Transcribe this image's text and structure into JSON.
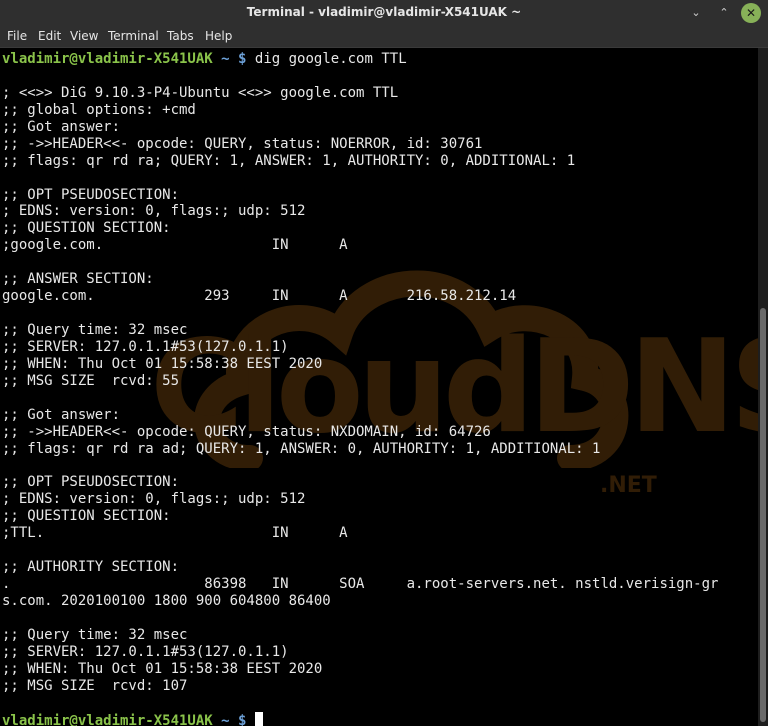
{
  "window": {
    "title": "Terminal - vladimir@vladimir-X541UAK ~",
    "minimize_icon": "minimize-icon",
    "maximize_icon": "maximize-icon",
    "close_icon": "close-icon",
    "minimize_glyph": "⌄",
    "maximize_glyph": "⌃",
    "close_glyph": "✕"
  },
  "menu": {
    "items": [
      "File",
      "Edit",
      "View",
      "Terminal",
      "Tabs",
      "Help"
    ]
  },
  "watermark": {
    "text": "CloudDNS",
    "suffix": ".NET"
  },
  "prompt": {
    "user_host": "vladimir@vladimir-X541UAK",
    "path": "~",
    "symbol": "$"
  },
  "command": "dig google.com TTL",
  "output_lines": [
    "",
    "; <<>> DiG 9.10.3-P4-Ubuntu <<>> google.com TTL",
    ";; global options: +cmd",
    ";; Got answer:",
    ";; ->>HEADER<<- opcode: QUERY, status: NOERROR, id: 30761",
    ";; flags: qr rd ra; QUERY: 1, ANSWER: 1, AUTHORITY: 0, ADDITIONAL: 1",
    "",
    ";; OPT PSEUDOSECTION:",
    "; EDNS: version: 0, flags:; udp: 512",
    ";; QUESTION SECTION:",
    ";google.com.                    IN      A",
    "",
    ";; ANSWER SECTION:",
    "google.com.             293     IN      A       216.58.212.14",
    "",
    ";; Query time: 32 msec",
    ";; SERVER: 127.0.1.1#53(127.0.1.1)",
    ";; WHEN: Thu Oct 01 15:58:38 EEST 2020",
    ";; MSG SIZE  rcvd: 55",
    "",
    ";; Got answer:",
    ";; ->>HEADER<<- opcode: QUERY, status: NXDOMAIN, id: 64726",
    ";; flags: qr rd ra ad; QUERY: 1, ANSWER: 0, AUTHORITY: 1, ADDITIONAL: 1",
    "",
    ";; OPT PSEUDOSECTION:",
    "; EDNS: version: 0, flags:; udp: 512",
    ";; QUESTION SECTION:",
    ";TTL.                           IN      A",
    "",
    ";; AUTHORITY SECTION:",
    ".                       86398   IN      SOA     a.root-servers.net. nstld.verisign-gr",
    "s.com. 2020100100 1800 900 604800 86400",
    "",
    ";; Query time: 32 msec",
    ";; SERVER: 127.0.1.1#53(127.0.1.1)",
    ";; WHEN: Thu Oct 01 15:58:38 EEST 2020",
    ";; MSG SIZE  rcvd: 107",
    ""
  ],
  "colors": {
    "user_host": "#8ac34a",
    "path": "#6da1d8",
    "text": "#e8e8e8",
    "background": "#000000",
    "watermark": "#3a2308"
  }
}
